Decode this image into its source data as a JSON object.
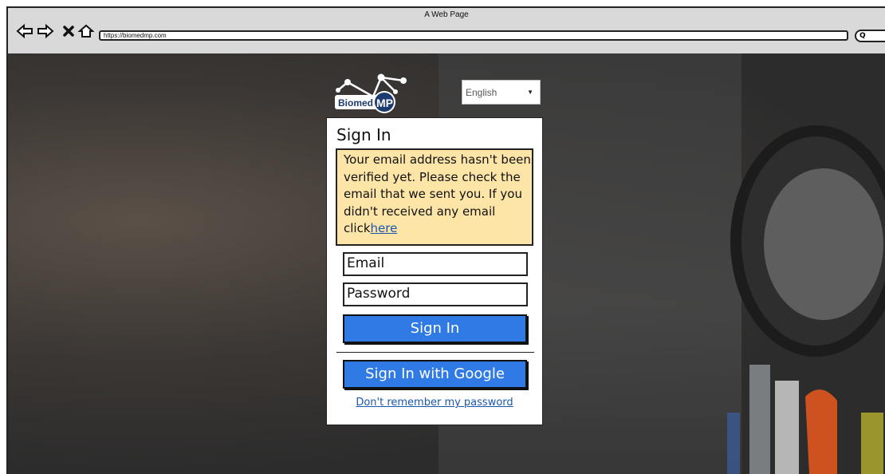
{
  "browser": {
    "title": "A Web Page",
    "url": "https://biomedmp.com",
    "search_glyph": "Q"
  },
  "logo": {
    "text_left": "Biomed",
    "text_right": "MP"
  },
  "language_select": {
    "selected": "English"
  },
  "signin": {
    "heading": "Sign In",
    "alert_text": "Your email address hasn't been verified yet. Please check the email that we sent you. If you didn't received any email click",
    "alert_link": "here",
    "email_placeholder": "Email",
    "password_placeholder": "Password",
    "signin_button": "Sign In",
    "google_button": "Sign In with Google",
    "forgot_link": "Don't remember my password"
  },
  "colors": {
    "button": "#2f7ae5",
    "alert_bg": "#fde5a8",
    "link": "#1a56b0"
  },
  "icons": [
    "back-arrow-icon",
    "forward-arrow-icon",
    "close-icon",
    "home-icon",
    "search-icon"
  ]
}
